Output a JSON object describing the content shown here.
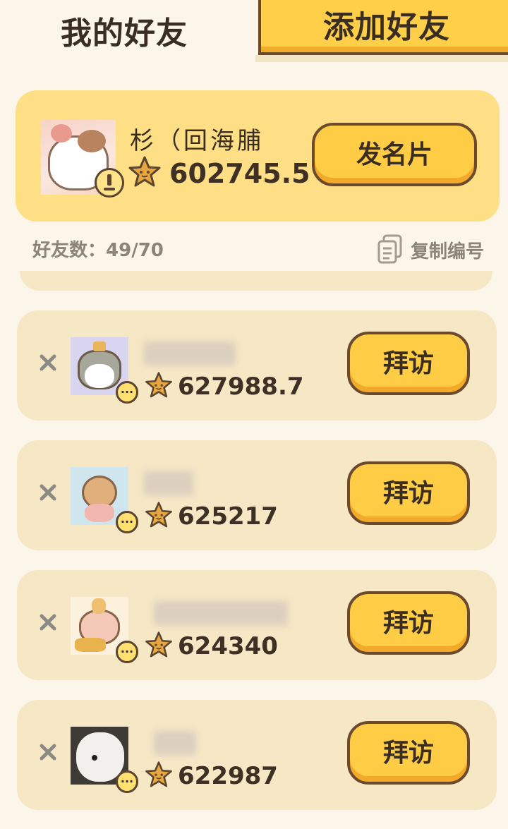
{
  "tabs": {
    "active": "我的好友",
    "inactive": "添加好友"
  },
  "self": {
    "name": "杉（回海脯",
    "score": "602745.5",
    "share_button": "发名片"
  },
  "friend_count": {
    "label": "好友数：",
    "value": "49/70"
  },
  "copy_id_label": "复制编号",
  "friends": [
    {
      "score": "627988.7",
      "visit": "拜访",
      "more": "···"
    },
    {
      "score": "625217",
      "visit": "拜访",
      "more": "···"
    },
    {
      "score": "624340",
      "visit": "拜访",
      "more": "···"
    },
    {
      "score": "622987",
      "visit": "拜访",
      "more": "···"
    }
  ],
  "colors": {
    "background": "#fbf5ea",
    "card": "#f6e7c5",
    "self_card": "#ffdf85",
    "button": "#ffcc45",
    "outline": "#6b4a2e"
  }
}
